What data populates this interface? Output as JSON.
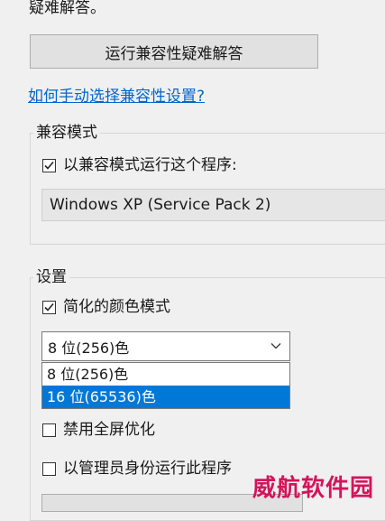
{
  "intro_text_tail": "疑难解答。",
  "troubleshoot": {
    "button_label": "运行兼容性疑难解答",
    "help_link": "如何手动选择兼容性设置?"
  },
  "compat_group": {
    "title": "兼容模式",
    "checkbox_label": "以兼容模式运行这个程序:",
    "checked": true,
    "os_value": "Windows XP (Service Pack 2)"
  },
  "settings_group": {
    "title": "设置",
    "reduced_color": {
      "label": "简化的颜色模式",
      "checked": true
    },
    "color_select": {
      "value": "8 位(256)色",
      "options": [
        "8 位(256)色",
        "16 位(65536)色"
      ],
      "highlighted_index": 1
    },
    "disable_fullscreen": {
      "label": "禁用全屏优化",
      "checked": false
    },
    "run_as_admin": {
      "label": "以管理员身份运行此程序",
      "checked": false
    }
  },
  "watermark": "威航软件园",
  "colors": {
    "window_bg": "#f0f0f0",
    "link": "#0066cc",
    "selection": "#0078d7",
    "watermark": "#d4145a"
  }
}
